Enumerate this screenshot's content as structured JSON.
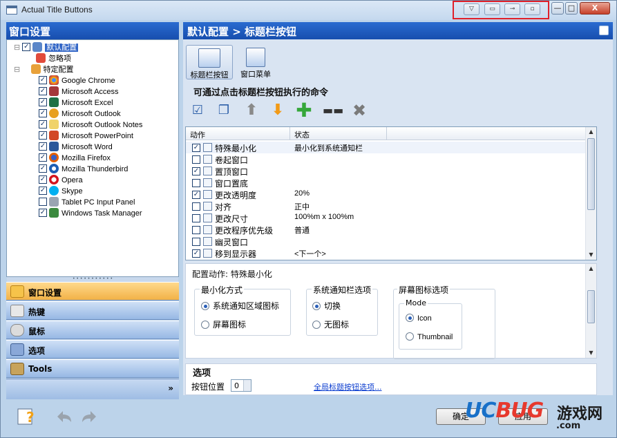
{
  "window": {
    "title": "Actual Title Buttons"
  },
  "title_buttons": [
    "▽",
    "▭",
    "⊸",
    "▫"
  ],
  "window_controls": {
    "minimize": "—",
    "maximize": "□",
    "close": "X"
  },
  "left": {
    "header": "窗口设置",
    "tree": [
      {
        "label": "默认配置",
        "checked": true,
        "selected": true,
        "icon": "window-icon"
      },
      {
        "label": "忽略项",
        "icon": "ignore-icon"
      },
      {
        "label": "特定配置",
        "icon": "folder-icon"
      },
      {
        "label": "Google Chrome",
        "checked": true,
        "icon": "chrome-icon"
      },
      {
        "label": "Microsoft Access",
        "checked": true,
        "icon": "access-icon"
      },
      {
        "label": "Microsoft Excel",
        "checked": true,
        "icon": "excel-icon"
      },
      {
        "label": "Microsoft Outlook",
        "checked": true,
        "icon": "outlook-icon"
      },
      {
        "label": "Microsoft Outlook Notes",
        "checked": true,
        "icon": "notes-icon"
      },
      {
        "label": "Microsoft PowerPoint",
        "checked": true,
        "icon": "powerpoint-icon"
      },
      {
        "label": "Microsoft Word",
        "checked": true,
        "icon": "word-icon"
      },
      {
        "label": "Mozilla Firefox",
        "checked": true,
        "icon": "firefox-icon"
      },
      {
        "label": "Mozilla Thunderbird",
        "checked": true,
        "icon": "thunderbird-icon"
      },
      {
        "label": "Opera",
        "checked": true,
        "icon": "opera-icon"
      },
      {
        "label": "Skype",
        "checked": true,
        "icon": "skype-icon"
      },
      {
        "label": "Tablet PC Input Panel",
        "checked": false,
        "icon": "tablet-icon"
      },
      {
        "label": "Windows Task Manager",
        "checked": true,
        "icon": "taskmgr-icon"
      }
    ],
    "nav": [
      "窗口设置",
      "热键",
      "鼠标",
      "选项",
      "Tools"
    ]
  },
  "right": {
    "header": "默认配置 > 标题栏按钮",
    "tabs": [
      "标题栏按钮",
      "窗口菜单"
    ],
    "commands_title": "可通过点击标题栏按钮执行的命令",
    "toolbar": [
      "checklist-icon",
      "copy-icon",
      "up-arrow-icon",
      "down-arrow-icon",
      "add-icon",
      "separator-icon",
      "delete-icon"
    ],
    "table": {
      "columns": [
        "动作",
        "状态"
      ],
      "rows": [
        {
          "action": "特殊最小化",
          "status": "最小化到系统通知栏",
          "checked": true
        },
        {
          "action": "卷起窗口",
          "status": "",
          "checked": false
        },
        {
          "action": "置顶窗口",
          "status": "",
          "checked": true
        },
        {
          "action": "窗口置底",
          "status": "",
          "checked": false
        },
        {
          "action": "更改透明度",
          "status": "20%",
          "checked": true
        },
        {
          "action": "对齐",
          "status": "正中",
          "checked": false
        },
        {
          "action": "更改尺寸",
          "status": "100%m x 100%m",
          "checked": false
        },
        {
          "action": "更改程序优先级",
          "status": "普通",
          "checked": false
        },
        {
          "action": "幽灵窗口",
          "status": "",
          "checked": false
        },
        {
          "action": "移到显示器",
          "status": "<下一个>",
          "checked": true
        }
      ]
    },
    "config": {
      "title": "配置动作: 特殊最小化",
      "min_group": {
        "title": "最小化方式",
        "options": [
          "系统通知区域图标",
          "屏幕图标"
        ],
        "selected": 0
      },
      "tray_group": {
        "title": "系统通知栏选项",
        "options": [
          "切换",
          "无图标"
        ],
        "selected": 0
      },
      "screen_group": {
        "title": "屏幕图标选项",
        "mode_title": "Mode",
        "options": [
          "Icon",
          "Thumbnail"
        ],
        "selected": 0
      }
    },
    "options": {
      "title": "选项",
      "button_position_label": "按钮位置",
      "button_position_value": "0",
      "global_link": "全局标题按钮选项..."
    }
  },
  "footer": {
    "ok": "确定",
    "apply": "应用"
  },
  "watermark": {
    "brand_a": "UC",
    "brand_b": "BUG",
    "game": "游戏网",
    "domain": ".com"
  }
}
